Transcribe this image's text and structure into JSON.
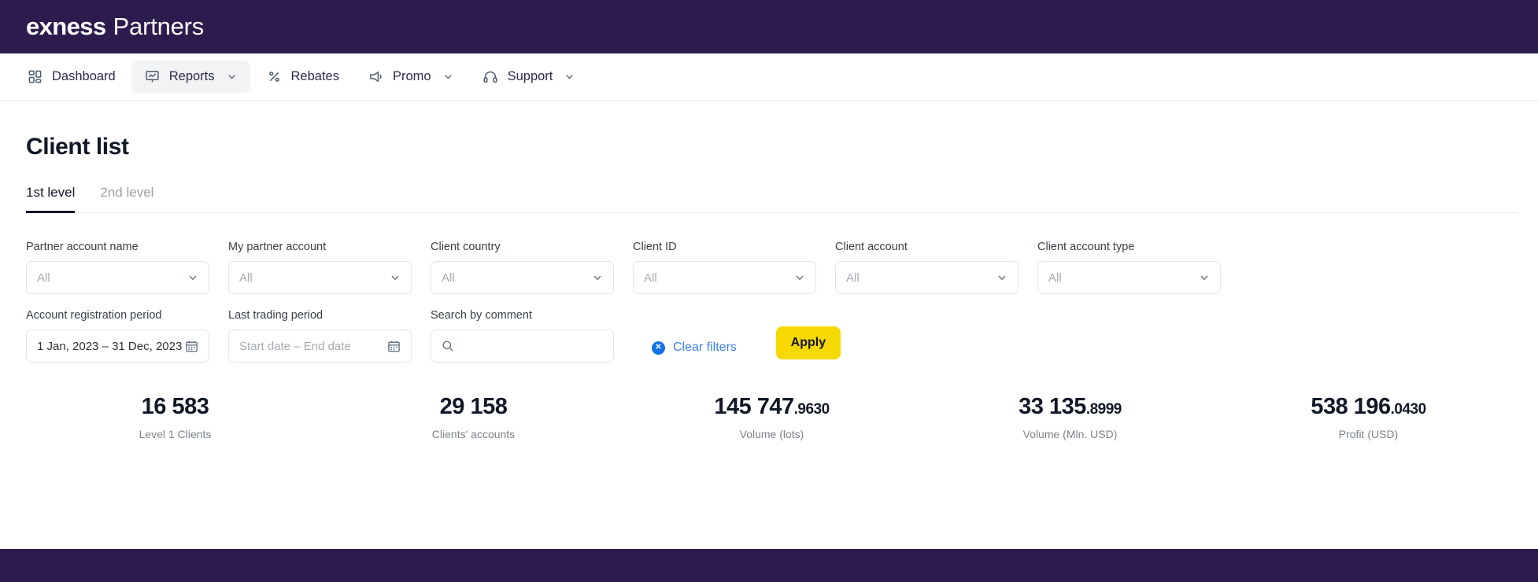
{
  "brand": {
    "name_bold": "exness",
    "name_light": "Partners",
    "bar_color": "#2d1b4e"
  },
  "nav": {
    "items": [
      {
        "label": "Dashboard",
        "icon": "grid-icon",
        "has_caret": false,
        "active": false
      },
      {
        "label": "Reports",
        "icon": "presentation-chart-icon",
        "has_caret": true,
        "active": true
      },
      {
        "label": "Rebates",
        "icon": "percent-icon",
        "has_caret": false,
        "active": false
      },
      {
        "label": "Promo",
        "icon": "megaphone-icon",
        "has_caret": true,
        "active": false
      },
      {
        "label": "Support",
        "icon": "headset-icon",
        "has_caret": true,
        "active": false
      }
    ]
  },
  "page": {
    "title": "Client list"
  },
  "tabs": [
    {
      "label": "1st level",
      "active": true
    },
    {
      "label": "2nd level",
      "active": false
    }
  ],
  "filters": {
    "selects": [
      {
        "label": "Partner account name",
        "value": "All"
      },
      {
        "label": "My partner account",
        "value": "All"
      },
      {
        "label": "Client country",
        "value": "All"
      },
      {
        "label": "Client ID",
        "value": "All"
      },
      {
        "label": "Client account",
        "value": "All"
      },
      {
        "label": "Client account type",
        "value": "All"
      }
    ],
    "account_registration_period": {
      "label": "Account registration period",
      "value": "1 Jan, 2023 – 31 Dec, 2023",
      "filled": true
    },
    "last_trading_period": {
      "label": "Last trading period",
      "value": "Start date – End date",
      "filled": false
    },
    "search_by_comment": {
      "label": "Search by comment",
      "value": "",
      "placeholder": ""
    },
    "clear_filters_label": "Clear filters",
    "clear_filters_color": "#3b82f6",
    "apply_label": "Apply",
    "apply_color": "#f5d900"
  },
  "stats": [
    {
      "int": "16 583",
      "dec": "",
      "label": "Level 1 Clients"
    },
    {
      "int": "29 158",
      "dec": "",
      "label": "Clients' accounts"
    },
    {
      "int": "145 747",
      "dec": ".9630",
      "label": "Volume (lots)"
    },
    {
      "int": "33 135",
      "dec": ".8999",
      "label": "Volume (Mln. USD)"
    },
    {
      "int": "538 196",
      "dec": ".0430",
      "label": "Profit (USD)"
    }
  ]
}
